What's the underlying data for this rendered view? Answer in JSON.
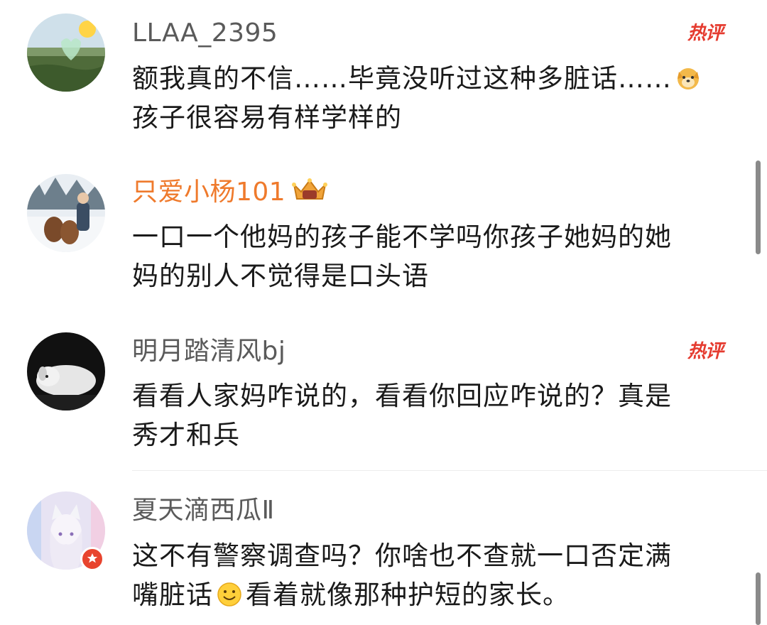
{
  "comments": [
    {
      "username": "LLAA_2395",
      "text_line1": "额我真的不信……毕竟没听过这种多脏话……",
      "text_line2": "孩子很容易有样学样的",
      "hot_label": "热评",
      "emoji": "dog-face-emoji"
    },
    {
      "username": "只爱小杨101",
      "text_line1": "一口一个他妈的孩子能不学吗你孩子她妈的她",
      "text_line2": "妈的别人不觉得是口头语",
      "badge": "crown-icon"
    },
    {
      "username": "明月踏清风bj",
      "text_line1": "看看人家妈咋说的，看看你回应咋说的？真是",
      "text_line2": "秀才和兵",
      "hot_label": "热评"
    },
    {
      "username": "夏天滴西瓜Ⅱ",
      "text_line1": "这不有警察调查吗？你啥也不查就一口否定满",
      "text_line2_a": "嘴脏话",
      "text_line2_b": "看着就像那种护短的家长。",
      "emoji": "smile-emoji",
      "badge": "verified-icon"
    }
  ],
  "colors": {
    "vip_username": "#ef7a2c",
    "username": "#5a5a5a",
    "hot": "#e53b2f"
  }
}
